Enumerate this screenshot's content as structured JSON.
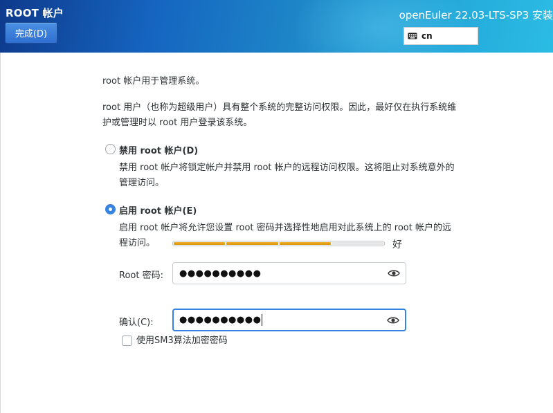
{
  "header": {
    "title": "ROOT 帐户",
    "done_label": "完成(D)",
    "product": "openEuler 22.03-LTS-SP3 安装",
    "keyboard_layout": "cn"
  },
  "intro": {
    "line1": "root 帐户用于管理系统。",
    "line2a": "root 用户（也称为超级用户）具有整个系统的完整访问权限。因此，最好仅在执行系统维",
    "line2b": "护或管理时以 root 用户登录该系统。"
  },
  "options": [
    {
      "label": "禁用 root 帐户(D)",
      "desc_a": "禁用 root 帐户将锁定帐户并禁用 root 帐户的远程访问权限。这将阻止对系统意外的",
      "desc_b": "管理访问。",
      "selected": false
    },
    {
      "label": "启用 root 帐户(E)",
      "desc_a": "启用 root 帐户将允许您设置 root 密码并选择性地启用对此系统上的 root 帐户的远",
      "desc_b": "程访问。",
      "selected": true
    }
  ],
  "password": {
    "label": "Root 密码:",
    "value": "●●●●●●●●●●",
    "strength_text": "好",
    "strength_level": 0.75
  },
  "confirm": {
    "label": "确认(C):",
    "value": "●●●●●●●●●●"
  },
  "sm3": {
    "label": "使用SM3算法加密密码",
    "checked": false
  },
  "colors": {
    "accent": "#3584e4",
    "strength_fill": "#e8a317"
  }
}
